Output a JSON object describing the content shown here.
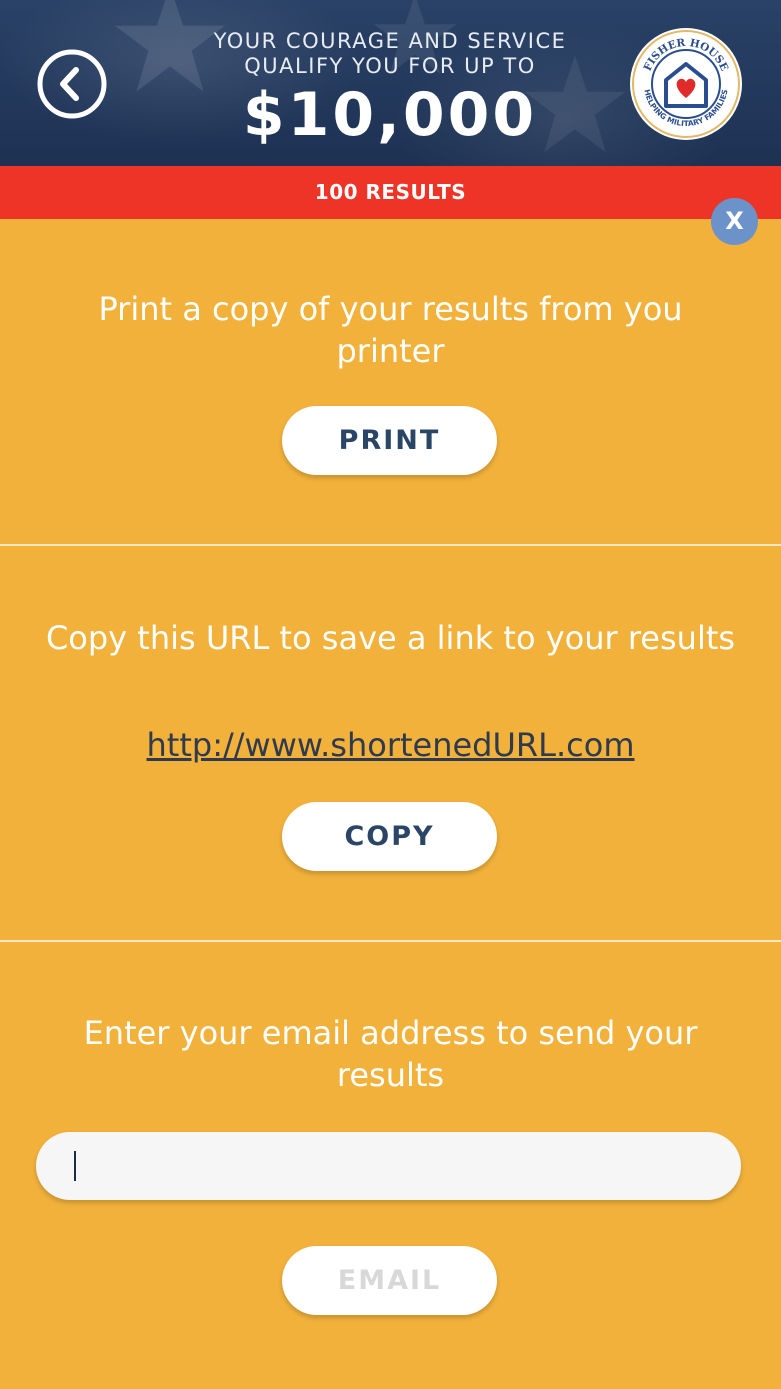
{
  "header": {
    "headline_line1": "YOUR COURAGE AND SERVICE",
    "headline_line2": "QUALIFY YOU FOR UP TO",
    "amount": "$10,000",
    "logo": {
      "name": "fisher-house-logo",
      "top_text": "FISHER HOUSE",
      "bottom_text": "HELPING MILITARY FAMILIES"
    }
  },
  "results_bar": {
    "label": "100 RESULTS"
  },
  "close_button": {
    "label": "X"
  },
  "print_section": {
    "text": "Print a copy of your results from you printer",
    "button_label": "PRINT"
  },
  "copy_section": {
    "text": "Copy this URL to save a link to your results",
    "url": "http://www.shortenedURL.com",
    "button_label": "COPY"
  },
  "email_section": {
    "text": "Enter your email address to send your results",
    "input_value": "",
    "button_label": "EMAIL"
  },
  "colors": {
    "header_bg": "#1f3557",
    "results_bar": "#ee3327",
    "page_bg": "#f1b13b",
    "close_button": "#6c93c9",
    "button_text": "#2a4565"
  }
}
